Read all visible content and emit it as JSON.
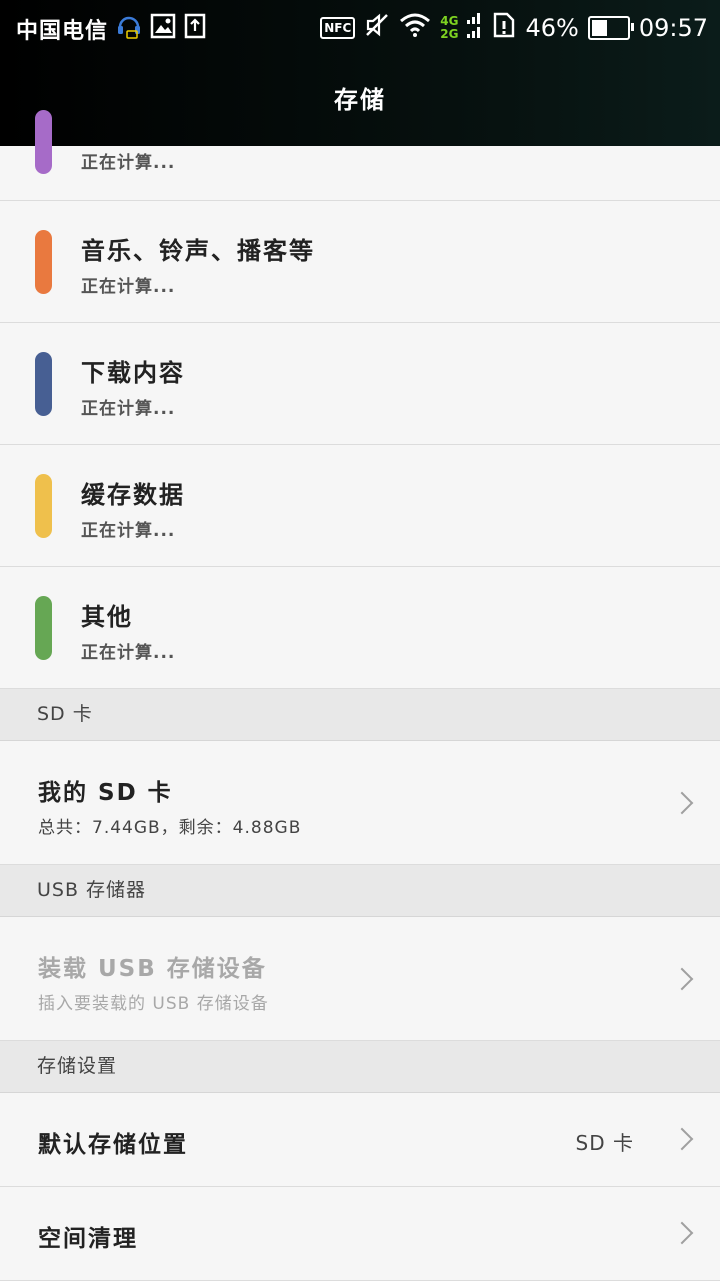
{
  "status_bar": {
    "carrier": "中国电信",
    "icons_left": [
      "headset-icon",
      "image-icon",
      "upload-icon"
    ],
    "nfc_label": "NFC",
    "net_4g": "4G",
    "net_2g": "2G",
    "battery_percent": "46%",
    "battery_level": 0.46,
    "time": "09:57"
  },
  "header": {
    "title": "存储"
  },
  "categories": [
    {
      "title": "",
      "subtitle": "正在计算...",
      "color": "#a66bc8"
    },
    {
      "title": "音乐、铃声、播客等",
      "subtitle": "正在计算...",
      "color": "#e9793f"
    },
    {
      "title": "下载内容",
      "subtitle": "正在计算...",
      "color": "#475f93"
    },
    {
      "title": "缓存数据",
      "subtitle": "正在计算...",
      "color": "#efc04c"
    },
    {
      "title": "其他",
      "subtitle": "正在计算...",
      "color": "#66a754"
    }
  ],
  "sd_section": {
    "header": "SD 卡",
    "item_title": "我的 SD 卡",
    "item_subtitle": "总共：7.44GB，剩余：4.88GB"
  },
  "usb_section": {
    "header": "USB 存储器",
    "item_title": "装载 USB 存储设备",
    "item_subtitle": "插入要装载的 USB 存储设备"
  },
  "storage_settings": {
    "header": "存储设置",
    "default_location_label": "默认存储位置",
    "default_location_value": "SD 卡",
    "cleanup_label": "空间清理"
  }
}
